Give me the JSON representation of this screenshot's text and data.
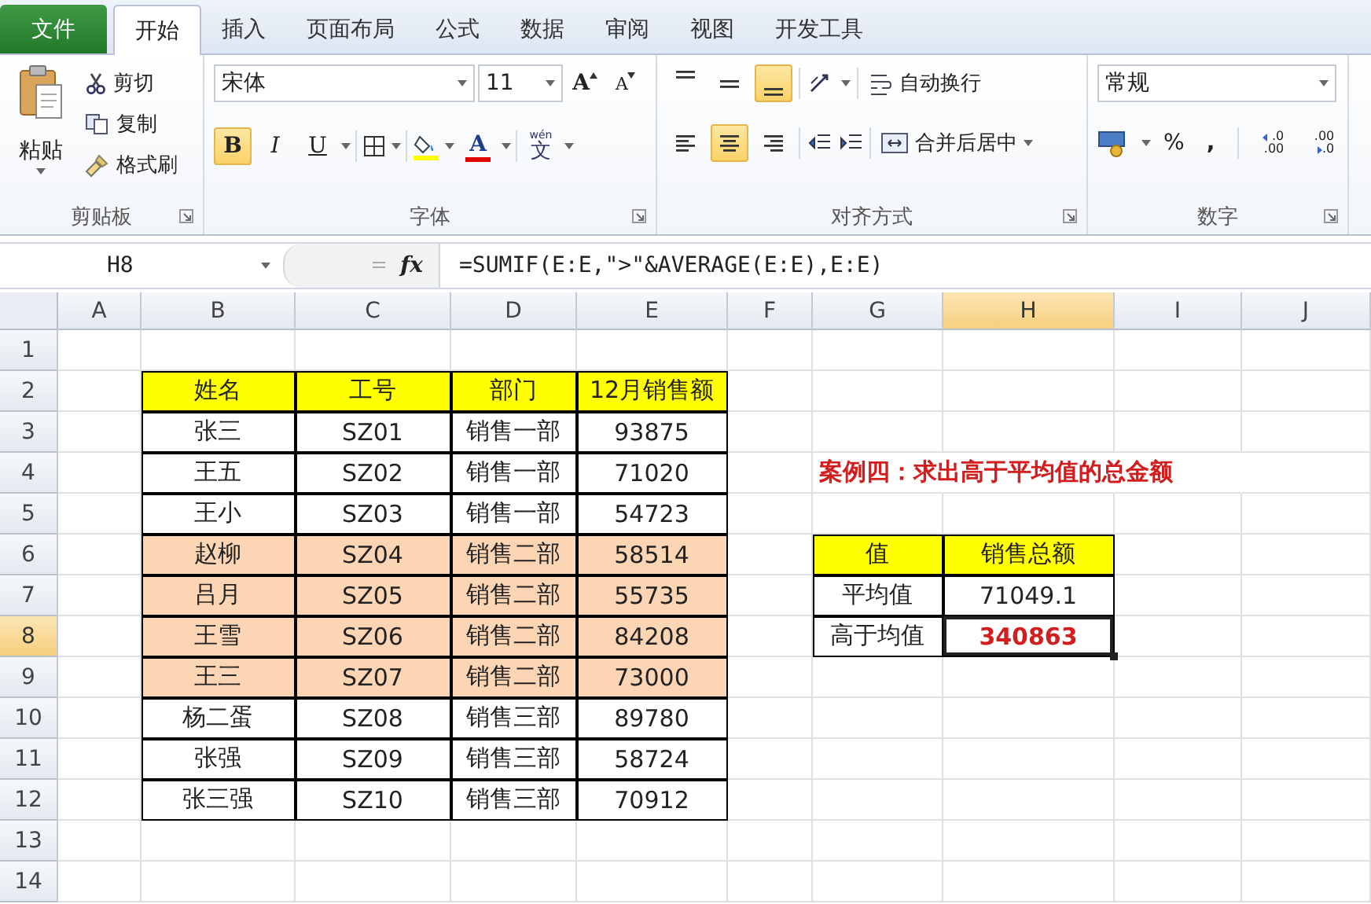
{
  "ribbon_tabs": [
    {
      "label": "文件",
      "kind": "file",
      "selected": false
    },
    {
      "label": "开始",
      "kind": "tab",
      "selected": true
    },
    {
      "label": "插入",
      "kind": "tab",
      "selected": false
    },
    {
      "label": "页面布局",
      "kind": "tab",
      "selected": false
    },
    {
      "label": "公式",
      "kind": "tab",
      "selected": false
    },
    {
      "label": "数据",
      "kind": "tab",
      "selected": false
    },
    {
      "label": "审阅",
      "kind": "tab",
      "selected": false
    },
    {
      "label": "视图",
      "kind": "tab",
      "selected": false
    },
    {
      "label": "开发工具",
      "kind": "tab",
      "selected": false
    }
  ],
  "clipboard": {
    "title": "剪贴板",
    "paste": "粘贴",
    "commands": [
      {
        "kind": "cut",
        "label": "剪切"
      },
      {
        "kind": "copy",
        "label": "复制"
      },
      {
        "kind": "painter",
        "label": "格式刷"
      }
    ]
  },
  "font": {
    "title": "字体",
    "name": "宋体",
    "size": "11",
    "grow": "A",
    "shrink": "A",
    "font_color": "A",
    "phonetic": {
      "label": "文",
      "ruby": "wén"
    },
    "styles": [
      {
        "kind": "bold",
        "label": "B",
        "selected": true
      },
      {
        "kind": "italic",
        "label": "I",
        "selected": false
      },
      {
        "kind": "underline",
        "label": "U",
        "selected": false
      }
    ]
  },
  "alignment": {
    "title": "对齐方式",
    "wrap": "自动换行",
    "merge": "合并后居中",
    "vertical": [
      {
        "kind": "top",
        "selected": false
      },
      {
        "kind": "middle",
        "selected": false
      },
      {
        "kind": "bottom",
        "selected": true
      }
    ],
    "horizontal": [
      {
        "kind": "left",
        "selected": false
      },
      {
        "kind": "center",
        "selected": true
      },
      {
        "kind": "right",
        "selected": false
      }
    ]
  },
  "number": {
    "title": "数字",
    "format": "常规",
    "percent": "%",
    "comma": ",",
    "decimals": [
      {
        "kind": "increase",
        "top": ".0",
        "bottom": ".00"
      },
      {
        "kind": "decrease",
        "top": ".00",
        "bottom": ".0"
      }
    ]
  },
  "formula_bar": {
    "name_box": "H8",
    "fx": "fx",
    "formula": "=SUMIF(E:E,\">\"&AVERAGE(E:E),E:E)"
  },
  "sheet": {
    "columns": [
      {
        "label": "A",
        "selected": false
      },
      {
        "label": "B",
        "selected": false
      },
      {
        "label": "C",
        "selected": false
      },
      {
        "label": "D",
        "selected": false
      },
      {
        "label": "E",
        "selected": false
      },
      {
        "label": "F",
        "selected": false
      },
      {
        "label": "G",
        "selected": false
      },
      {
        "label": "H",
        "selected": true
      },
      {
        "label": "I",
        "selected": false
      },
      {
        "label": "J",
        "selected": false
      }
    ],
    "rows": [
      {
        "label": "1",
        "selected": false
      },
      {
        "label": "2",
        "selected": false,
        "cells": [
          null,
          {
            "text": "姓名",
            "color": "#ffff00",
            "bordered": true,
            "emphasis": false,
            "selected": false
          },
          {
            "text": "工号",
            "color": "#ffff00",
            "bordered": true,
            "emphasis": false,
            "selected": false
          },
          {
            "text": "部门",
            "color": "#ffff00",
            "bordered": true,
            "emphasis": false,
            "selected": false
          },
          {
            "text": "12月销售额",
            "color": "#ffff00",
            "bordered": true,
            "emphasis": false,
            "selected": false
          },
          null,
          null,
          null,
          null,
          null
        ]
      },
      {
        "label": "3",
        "selected": false,
        "cells": [
          null,
          {
            "text": "张三",
            "color": "#ffffff",
            "bordered": true,
            "emphasis": false,
            "selected": false
          },
          {
            "text": "SZ01",
            "color": "#ffffff",
            "bordered": true,
            "emphasis": false,
            "selected": false
          },
          {
            "text": "销售一部",
            "color": "#ffffff",
            "bordered": true,
            "emphasis": false,
            "selected": false
          },
          {
            "text": "93875",
            "color": "#ffffff",
            "bordered": true,
            "emphasis": false,
            "selected": false
          },
          null,
          null,
          null,
          null,
          null
        ]
      },
      {
        "label": "4",
        "selected": false,
        "cells": [
          null,
          {
            "text": "王五",
            "color": "#ffffff",
            "bordered": true,
            "emphasis": false,
            "selected": false
          },
          {
            "text": "SZ02",
            "color": "#ffffff",
            "bordered": true,
            "emphasis": false,
            "selected": false
          },
          {
            "text": "销售一部",
            "color": "#ffffff",
            "bordered": true,
            "emphasis": false,
            "selected": false
          },
          {
            "text": "71020",
            "color": "#ffffff",
            "bordered": true,
            "emphasis": false,
            "selected": false
          },
          null,
          {
            "text": "案例四：求出高于平均值的总金额",
            "kind": "title",
            "color": "#ffffff",
            "bordered": false,
            "emphasis": true,
            "selected": false
          },
          null,
          null,
          null
        ]
      },
      {
        "label": "5",
        "selected": false,
        "cells": [
          null,
          {
            "text": "王小",
            "color": "#ffffff",
            "bordered": true,
            "emphasis": false,
            "selected": false
          },
          {
            "text": "SZ03",
            "color": "#ffffff",
            "bordered": true,
            "emphasis": false,
            "selected": false
          },
          {
            "text": "销售一部",
            "color": "#ffffff",
            "bordered": true,
            "emphasis": false,
            "selected": false
          },
          {
            "text": "54723",
            "color": "#ffffff",
            "bordered": true,
            "emphasis": false,
            "selected": false
          },
          null,
          null,
          null,
          null,
          null
        ]
      },
      {
        "label": "6",
        "selected": false,
        "cells": [
          null,
          {
            "text": "赵柳",
            "color": "#fcd5b4",
            "bordered": true,
            "emphasis": false,
            "selected": false
          },
          {
            "text": "SZ04",
            "color": "#fcd5b4",
            "bordered": true,
            "emphasis": false,
            "selected": false
          },
          {
            "text": "销售二部",
            "color": "#fcd5b4",
            "bordered": true,
            "emphasis": false,
            "selected": false
          },
          {
            "text": "58514",
            "color": "#fcd5b4",
            "bordered": true,
            "emphasis": false,
            "selected": false
          },
          null,
          {
            "text": "值",
            "color": "#ffff00",
            "bordered": true,
            "emphasis": false,
            "selected": false
          },
          {
            "text": "销售总额",
            "color": "#ffff00",
            "bordered": true,
            "emphasis": false,
            "selected": false
          },
          null,
          null
        ]
      },
      {
        "label": "7",
        "selected": false,
        "cells": [
          null,
          {
            "text": "吕月",
            "color": "#fcd5b4",
            "bordered": true,
            "emphasis": false,
            "selected": false
          },
          {
            "text": "SZ05",
            "color": "#fcd5b4",
            "bordered": true,
            "emphasis": false,
            "selected": false
          },
          {
            "text": "销售二部",
            "color": "#fcd5b4",
            "bordered": true,
            "emphasis": false,
            "selected": false
          },
          {
            "text": "55735",
            "color": "#fcd5b4",
            "bordered": true,
            "emphasis": false,
            "selected": false
          },
          null,
          {
            "text": "平均值",
            "color": "#ffffff",
            "bordered": true,
            "emphasis": false,
            "selected": false
          },
          {
            "text": "71049.1",
            "color": "#ffffff",
            "bordered": true,
            "emphasis": false,
            "selected": false
          },
          null,
          null
        ]
      },
      {
        "label": "8",
        "selected": true,
        "cells": [
          null,
          {
            "text": "王雪",
            "color": "#fcd5b4",
            "bordered": true,
            "emphasis": false,
            "selected": false
          },
          {
            "text": "SZ06",
            "color": "#fcd5b4",
            "bordered": true,
            "emphasis": false,
            "selected": false
          },
          {
            "text": "销售二部",
            "color": "#fcd5b4",
            "bordered": true,
            "emphasis": false,
            "selected": false
          },
          {
            "text": "84208",
            "color": "#fcd5b4",
            "bordered": true,
            "emphasis": false,
            "selected": false
          },
          null,
          {
            "text": "高于均值",
            "color": "#ffffff",
            "bordered": true,
            "emphasis": false,
            "selected": false
          },
          {
            "text": "340863",
            "color": "#ffffff",
            "bordered": true,
            "emphasis": true,
            "selected": true
          },
          null,
          null
        ]
      },
      {
        "label": "9",
        "selected": false,
        "cells": [
          null,
          {
            "text": "王三",
            "color": "#fcd5b4",
            "bordered": true,
            "emphasis": false,
            "selected": false
          },
          {
            "text": "SZ07",
            "color": "#fcd5b4",
            "bordered": true,
            "emphasis": false,
            "selected": false
          },
          {
            "text": "销售二部",
            "color": "#fcd5b4",
            "bordered": true,
            "emphasis": false,
            "selected": false
          },
          {
            "text": "73000",
            "color": "#fcd5b4",
            "bordered": true,
            "emphasis": false,
            "selected": false
          },
          null,
          null,
          null,
          null,
          null
        ]
      },
      {
        "label": "10",
        "selected": false,
        "cells": [
          null,
          {
            "text": "杨二蛋",
            "color": "#ffffff",
            "bordered": true,
            "emphasis": false,
            "selected": false
          },
          {
            "text": "SZ08",
            "color": "#ffffff",
            "bordered": true,
            "emphasis": false,
            "selected": false
          },
          {
            "text": "销售三部",
            "color": "#ffffff",
            "bordered": true,
            "emphasis": false,
            "selected": false
          },
          {
            "text": "89780",
            "color": "#ffffff",
            "bordered": true,
            "emphasis": false,
            "selected": false
          },
          null,
          null,
          null,
          null,
          null
        ]
      },
      {
        "label": "11",
        "selected": false,
        "cells": [
          null,
          {
            "text": "张强",
            "color": "#ffffff",
            "bordered": true,
            "emphasis": false,
            "selected": false
          },
          {
            "text": "SZ09",
            "color": "#ffffff",
            "bordered": true,
            "emphasis": false,
            "selected": false
          },
          {
            "text": "销售三部",
            "color": "#ffffff",
            "bordered": true,
            "emphasis": false,
            "selected": false
          },
          {
            "text": "58724",
            "color": "#ffffff",
            "bordered": true,
            "emphasis": false,
            "selected": false
          },
          null,
          null,
          null,
          null,
          null
        ]
      },
      {
        "label": "12",
        "selected": false,
        "cells": [
          null,
          {
            "text": "张三强",
            "color": "#ffffff",
            "bordered": true,
            "emphasis": false,
            "selected": false
          },
          {
            "text": "SZ10",
            "color": "#ffffff",
            "bordered": true,
            "emphasis": false,
            "selected": false
          },
          {
            "text": "销售三部",
            "color": "#ffffff",
            "bordered": true,
            "emphasis": false,
            "selected": false
          },
          {
            "text": "70912",
            "color": "#ffffff",
            "bordered": true,
            "emphasis": false,
            "selected": false
          },
          null,
          null,
          null,
          null,
          null
        ]
      },
      {
        "label": "13",
        "selected": false
      },
      {
        "label": "14",
        "selected": false
      }
    ]
  }
}
